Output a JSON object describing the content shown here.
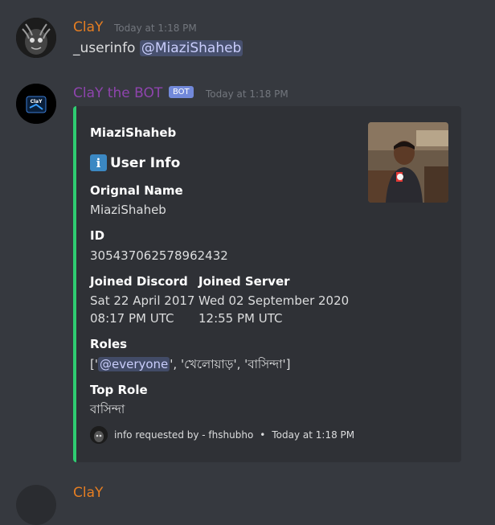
{
  "messages": [
    {
      "username": "ClaY",
      "username_color": "#e67e22",
      "timestamp": "Today at 1:18 PM",
      "content_prefix": "_userinfo",
      "mention": "@MiaziShaheb"
    },
    {
      "username": "ClaY the BOT",
      "username_color": "#8e44ad",
      "bot_tag": "BOT",
      "timestamp": "Today at 1:18 PM",
      "avatar_text": "ClaY"
    }
  ],
  "embed": {
    "accent_color": "#2ecc71",
    "author": "MiaziShaheb",
    "title": "User Info",
    "title_icon": "info-icon",
    "fields": {
      "original_name": {
        "name": "Orignal Name",
        "value": "MiaziShaheb"
      },
      "id": {
        "name": "ID",
        "value": "305437062578962432"
      },
      "joined_discord": {
        "name": "Joined Discord",
        "line1": "Sat 22 April 2017",
        "line2": "08:17 PM UTC"
      },
      "joined_server": {
        "name": "Joined Server",
        "line1": "Wed 02 September 2020",
        "line2": "12:55 PM UTC"
      },
      "roles": {
        "name": "Roles",
        "prefix": "['",
        "mention": "@everyone",
        "suffix": "', 'খেলোয়াড়', 'বাসিন্দা']"
      },
      "top_role": {
        "name": "Top Role",
        "value": "বাসিন্দা"
      }
    },
    "footer": {
      "text": "info requested by - fhshubho",
      "separator": "•",
      "timestamp": "Today at 1:18 PM"
    }
  },
  "next_message": {
    "username": "ClaY"
  }
}
